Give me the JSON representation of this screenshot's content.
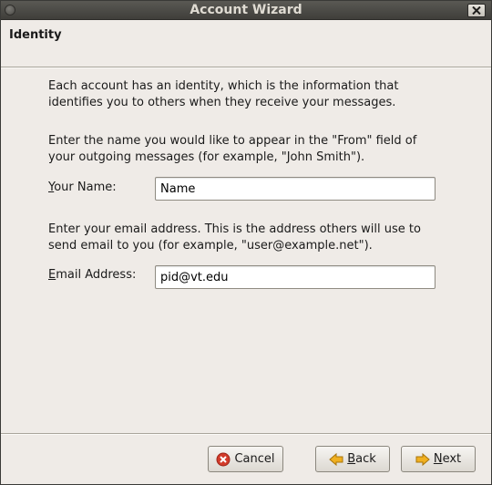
{
  "window": {
    "title": "Account Wizard"
  },
  "header": {
    "title": "Identity"
  },
  "content": {
    "intro": "Each account has an identity, which is the information that identifies you to others when they receive your messages.",
    "name_instructions": "Enter the name you would like to appear in the \"From\" field of your outgoing messages (for example, \"John Smith\").",
    "name_label_prefix": "",
    "name_label_mnemonic": "Y",
    "name_label_rest": "our Name:",
    "name_value": "Name",
    "email_instructions": "Enter your email address. This is the address others will use to send email to you (for example, \"user@example.net\").",
    "email_label_mnemonic": "E",
    "email_label_rest": "mail Address:",
    "email_value": "pid@vt.edu"
  },
  "buttons": {
    "cancel": "Cancel",
    "back_mnemonic": "B",
    "back_rest": "ack",
    "next_mnemonic": "N",
    "next_rest": "ext"
  },
  "icons": {
    "window_menu": "window-menu-icon",
    "close": "close-icon",
    "cancel": "cancel-icon",
    "back": "arrow-left-icon",
    "next": "arrow-right-icon"
  },
  "colors": {
    "cancel_icon": "#d23b2a",
    "arrow_icon": "#f0b020"
  }
}
